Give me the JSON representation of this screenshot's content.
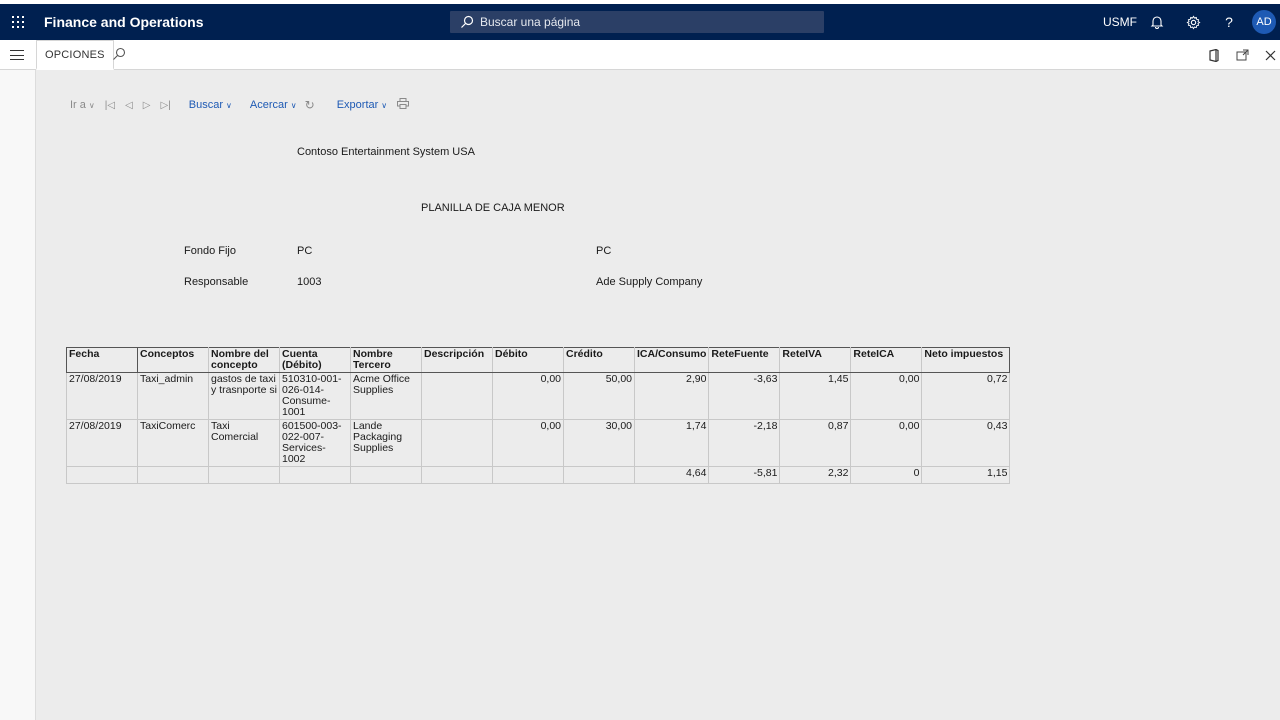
{
  "topbar": {
    "app_title": "Finance and Operations",
    "search_placeholder": "Buscar una página",
    "company": "USMF",
    "avatar_initials": "AD",
    "help_label": "?"
  },
  "actionbar": {
    "tab_label": "OPCIONES"
  },
  "toolbar": {
    "goto_label": "Ir a",
    "find_label": "Buscar",
    "zoom_label": "Acercar",
    "export_label": "Exportar"
  },
  "report": {
    "company_name": "Contoso Entertainment System USA",
    "title": "PLANILLA DE CAJA MENOR",
    "fondo_fijo_label": "Fondo Fijo",
    "fondo_fijo_value": "PC",
    "fondo_fijo_desc": "PC",
    "responsable_label": "Responsable",
    "responsable_value": "1003",
    "responsable_desc": "Ade Supply Company",
    "columns": [
      "Fecha",
      "Conceptos",
      "Nombre del concepto",
      "Cuenta (Débito)",
      "Nombre Tercero",
      "Descripción",
      "Débito",
      "Crédito",
      "ICA/Consumo",
      "ReteFuente",
      "ReteIVA",
      "ReteICA",
      "Neto impuestos"
    ],
    "rows": [
      {
        "fecha": "27/08/2019",
        "concepto": "Taxi_admin",
        "nombre_concepto": "gastos de taxi y trasnporte si",
        "cuenta": "510310-001-026-014-Consume-1001",
        "tercero": "Acme Office Supplies",
        "descripcion": "",
        "debito": "0,00",
        "credito": "50,00",
        "ica": "2,90",
        "retefuente": "-3,63",
        "reteiva": "1,45",
        "reteica": "0,00",
        "neto": "0,72"
      },
      {
        "fecha": "27/08/2019",
        "concepto": "TaxiComerc",
        "nombre_concepto": "Taxi Comercial",
        "cuenta": "601500-003-022-007-Services-1002",
        "tercero": "Lande Packaging Supplies",
        "descripcion": "",
        "debito": "0,00",
        "credito": "30,00",
        "ica": "1,74",
        "retefuente": "-2,18",
        "reteiva": "0,87",
        "reteica": "0,00",
        "neto": "0,43"
      }
    ],
    "totals": {
      "ica": "4,64",
      "retefuente": "-5,81",
      "reteiva": "2,32",
      "reteica": "0",
      "neto": "1,15"
    }
  }
}
